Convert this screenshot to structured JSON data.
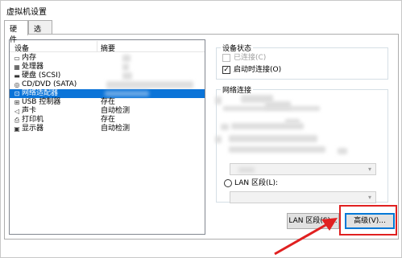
{
  "window": {
    "title": "虚拟机设置"
  },
  "tabs": [
    {
      "label": "硬件"
    },
    {
      "label": "选项"
    }
  ],
  "device_list": {
    "headers": {
      "device": "设备",
      "summary": "摘要"
    },
    "rows": [
      {
        "name": "内存",
        "summary": "",
        "icon": "memory-icon"
      },
      {
        "name": "处理器",
        "summary": "",
        "icon": "cpu-icon"
      },
      {
        "name": "硬盘 (SCSI)",
        "summary": "",
        "icon": "harddisk-icon"
      },
      {
        "name": "CD/DVD (SATA)",
        "summary": "",
        "icon": "cd-dvd-icon"
      },
      {
        "name": "网络适配器",
        "summary": "",
        "icon": "network-adapter-icon",
        "selected": true
      },
      {
        "name": "USB 控制器",
        "summary": "存在",
        "icon": "usb-icon"
      },
      {
        "name": "声卡",
        "summary": "自动检测",
        "icon": "sound-icon"
      },
      {
        "name": "打印机",
        "summary": "存在",
        "icon": "printer-icon"
      },
      {
        "name": "显示器",
        "summary": "自动检测",
        "icon": "display-icon"
      }
    ]
  },
  "device_status": {
    "title": "设备状态",
    "connected": {
      "label": "已连接(C)",
      "checked": false,
      "disabled": true
    },
    "connect_on_power": {
      "label": "启动时连接(O)",
      "checked": true
    }
  },
  "network_connection": {
    "title": "网络连接",
    "lan_segment": {
      "label": "LAN 区段(L):"
    }
  },
  "buttons": {
    "lan_segments": "LAN 区段(S)...",
    "advanced": "高级(V)..."
  },
  "colors": {
    "selection": "#0b74d8",
    "highlight": "#e02020"
  }
}
